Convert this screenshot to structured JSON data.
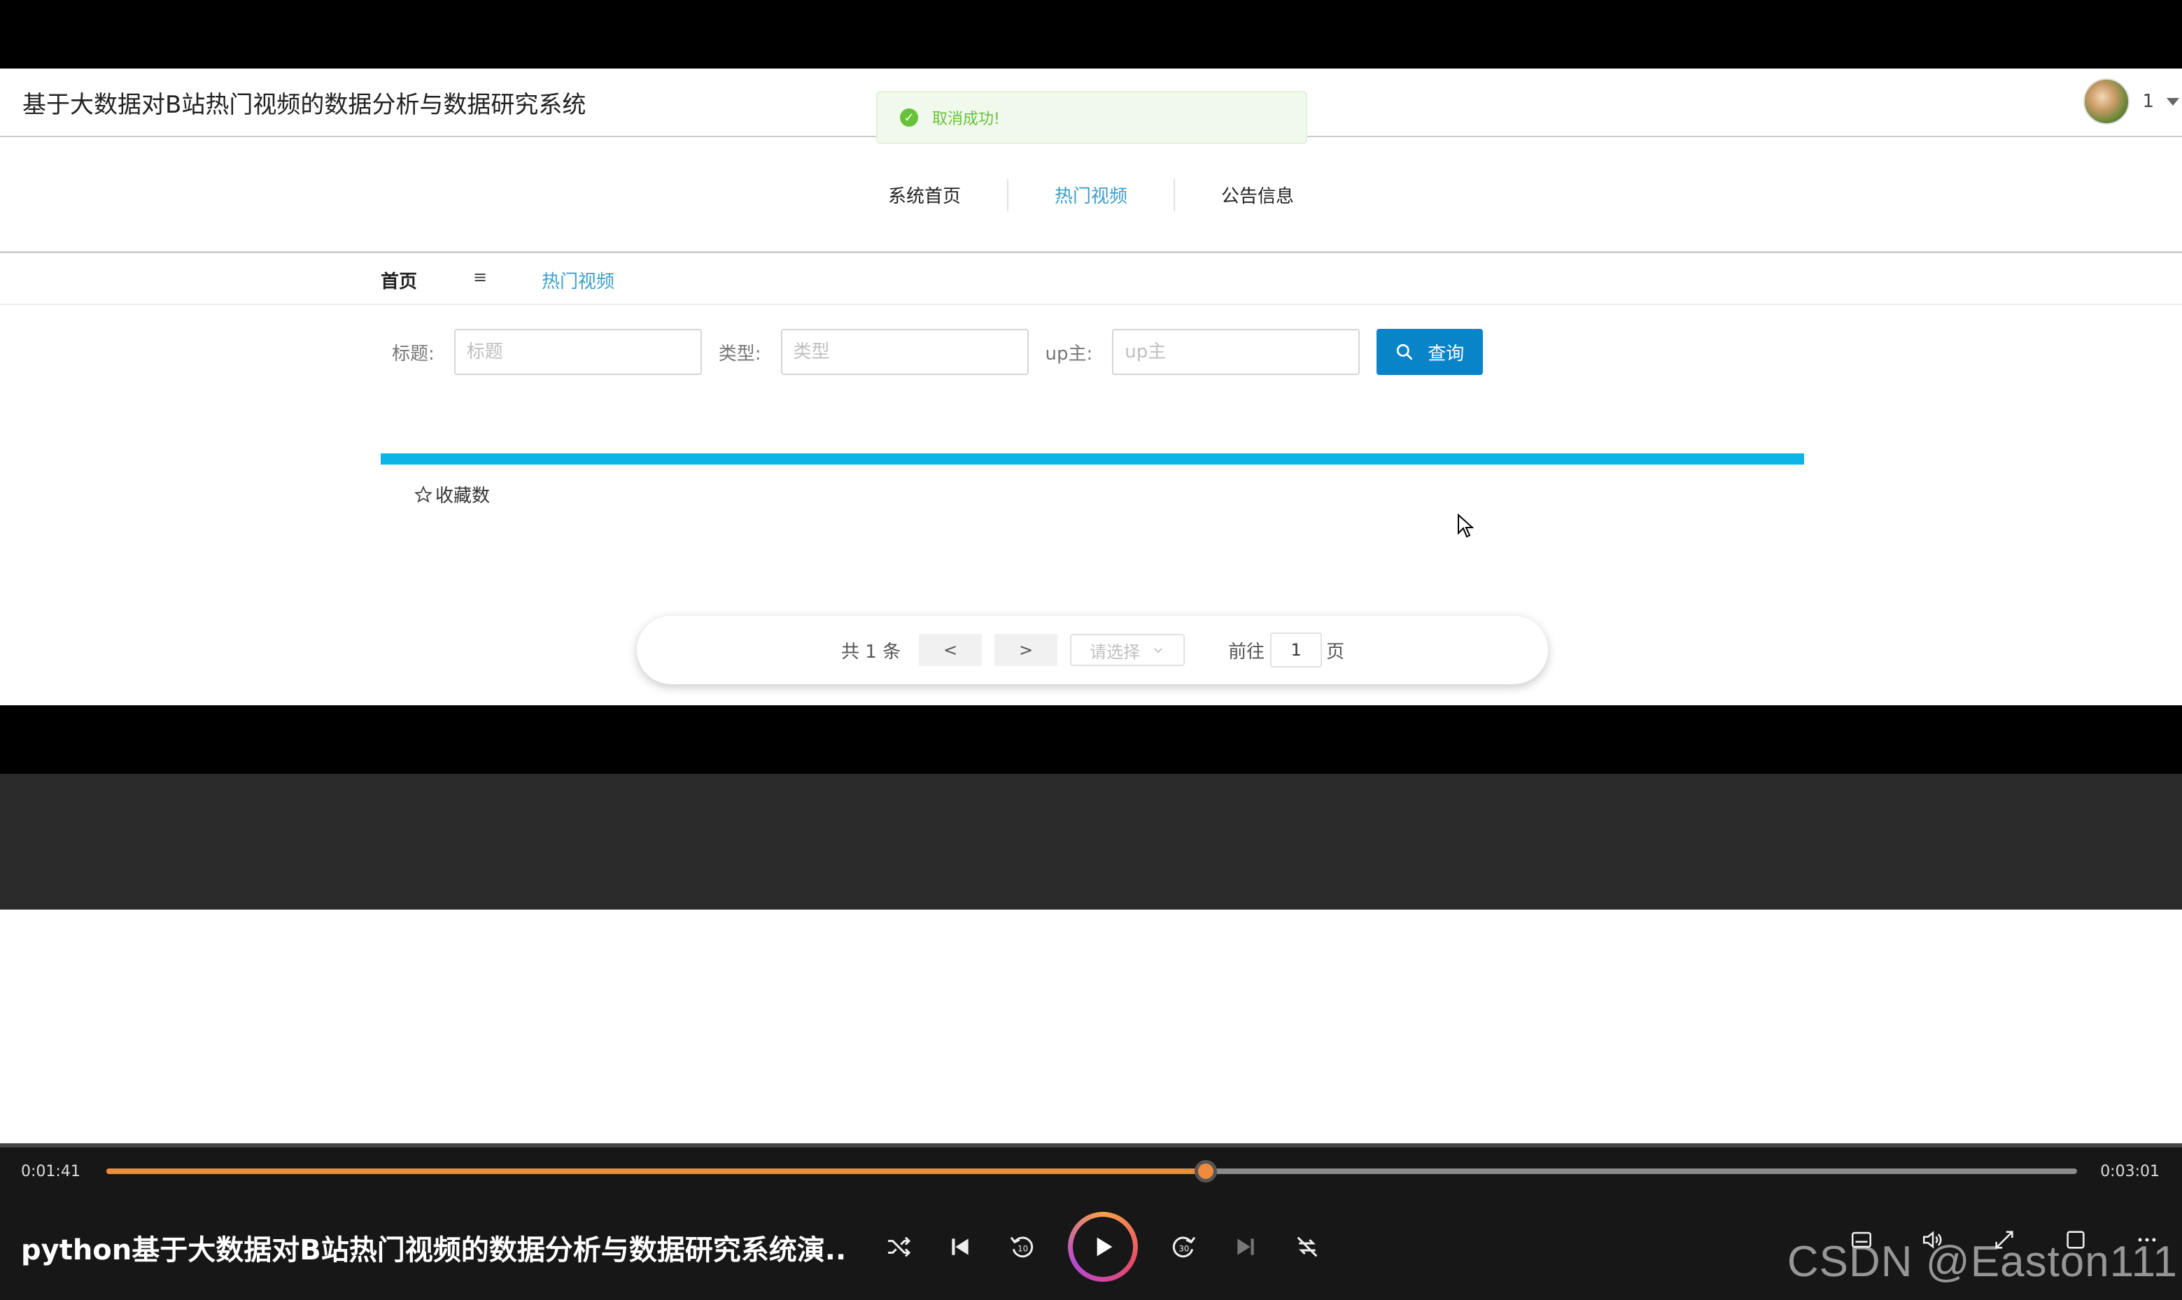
{
  "site": {
    "title": "基于大数据对B站热门视频的数据分析与数据研究系统",
    "user_name": "1"
  },
  "toast": {
    "message": "取消成功!",
    "icon": "success-check-icon",
    "color": "#67c23a"
  },
  "nav": {
    "items": [
      {
        "label": "系统首页",
        "active": false
      },
      {
        "label": "热门视频",
        "active": true
      },
      {
        "label": "公告信息",
        "active": false
      }
    ]
  },
  "breadcrumb": {
    "home": "首页",
    "separator": "≡",
    "current": "热门视频"
  },
  "search": {
    "title_label": "标题:",
    "title_placeholder": "标题",
    "type_label": "类型:",
    "type_placeholder": "类型",
    "up_label": "up主:",
    "up_placeholder": "up主",
    "button_label": "查询"
  },
  "content": {
    "favorites_label": "收藏数",
    "accent_color": "#0db4e6"
  },
  "pagination": {
    "total": "共 1 条",
    "prev": "<",
    "next": ">",
    "page_size_placeholder": "请选择",
    "goto_label": "前往",
    "page_number": "1",
    "page_suffix": "页"
  },
  "player": {
    "current_time": "0:01:41",
    "total_time": "0:03:01",
    "progress_fraction": 0.558,
    "video_title": "python基于大数据对B站热门视频的数据分析与数据研究系统演...",
    "watermark": "CSDN @Easton111",
    "progress_color": "#f08a3c"
  }
}
